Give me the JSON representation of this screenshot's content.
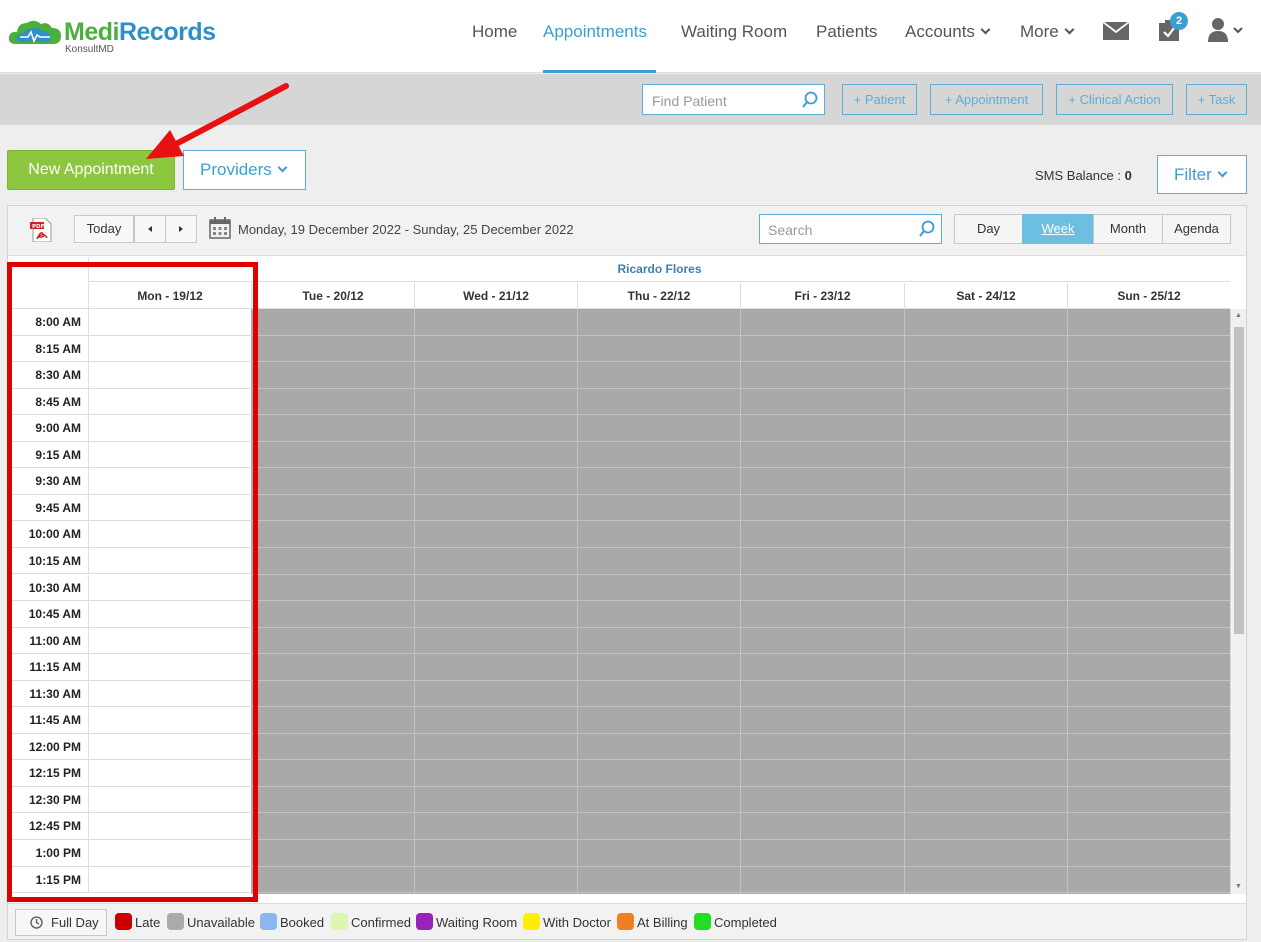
{
  "brand": {
    "name_part1": "Medi",
    "name_part2": "Records",
    "sub": "KonsultMD"
  },
  "nav": {
    "home": "Home",
    "appointments": "Appointments",
    "waiting_room": "Waiting Room",
    "patients": "Patients",
    "accounts": "Accounts",
    "more": "More",
    "tasks_badge": "2"
  },
  "actionbar": {
    "find_patient_placeholder": "Find Patient",
    "add_patient": "+ Patient",
    "add_appointment": "+ Appointment",
    "add_clinical_action": "+ Clinical Action",
    "add_task": "+ Task"
  },
  "controls": {
    "new_appointment": "New Appointment",
    "providers": "Providers",
    "sms_label": "SMS Balance :",
    "sms_value": "0",
    "filter": "Filter"
  },
  "calendar": {
    "today": "Today",
    "date_range": "Monday, 19 December 2022 - Sunday, 25 December 2022",
    "search_placeholder": "Search",
    "views": [
      "Day",
      "Week",
      "Month",
      "Agenda"
    ],
    "active_view": "Week",
    "provider": "Ricardo Flores",
    "days": [
      "Mon - 19/12",
      "Tue - 20/12",
      "Wed - 21/12",
      "Thu - 22/12",
      "Fri - 23/12",
      "Sat - 24/12",
      "Sun - 25/12"
    ],
    "times": [
      "8:00 AM",
      "8:15 AM",
      "8:30 AM",
      "8:45 AM",
      "9:00 AM",
      "9:15 AM",
      "9:30 AM",
      "9:45 AM",
      "10:00 AM",
      "10:15 AM",
      "10:30 AM",
      "10:45 AM",
      "11:00 AM",
      "11:15 AM",
      "11:30 AM",
      "11:45 AM",
      "12:00 PM",
      "12:15 PM",
      "12:30 PM",
      "12:45 PM",
      "1:00 PM",
      "1:15 PM"
    ]
  },
  "legend": {
    "full_day": "Full Day",
    "items": [
      {
        "label": "Late",
        "color": "#cc0000"
      },
      {
        "label": "Unavailable",
        "color": "#aaaaaa"
      },
      {
        "label": "Booked",
        "color": "#8ab8ee"
      },
      {
        "label": "Confirmed",
        "color": "#dcf7b0"
      },
      {
        "label": "Waiting Room",
        "color": "#9922bb"
      },
      {
        "label": "With Doctor",
        "color": "#ffee00"
      },
      {
        "label": "At Billing",
        "color": "#f07f22"
      },
      {
        "label": "Completed",
        "color": "#22dd22"
      }
    ]
  }
}
